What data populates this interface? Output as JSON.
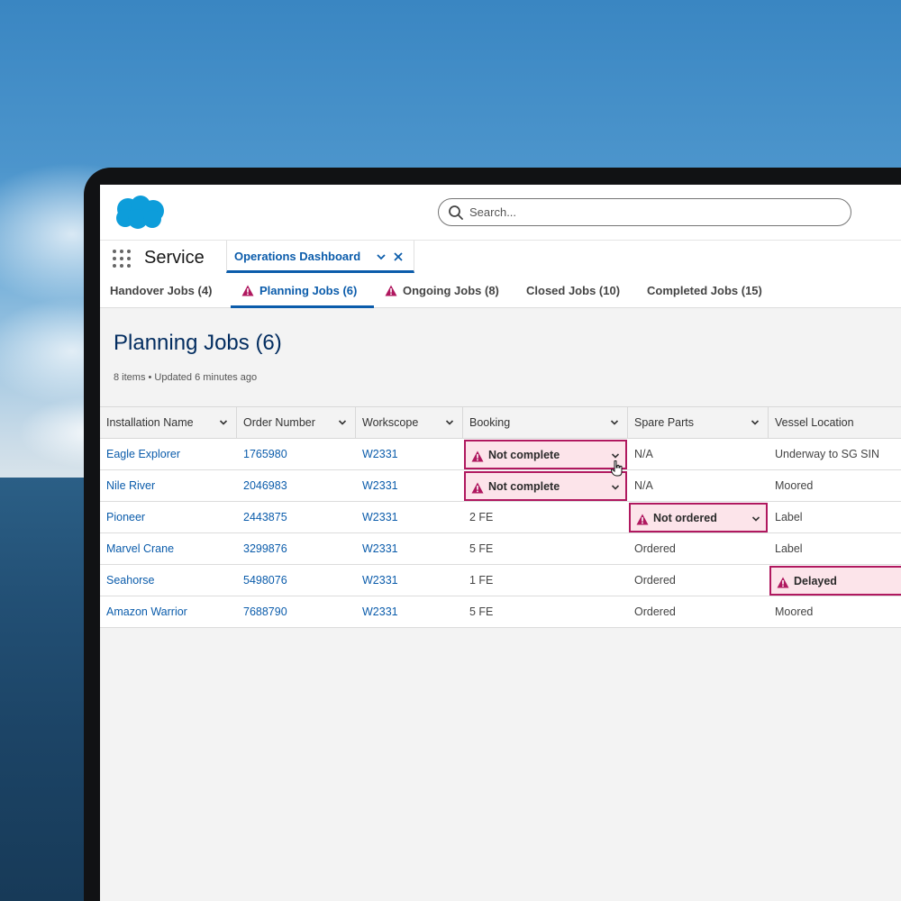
{
  "app": {
    "name": "Service"
  },
  "search": {
    "placeholder": "Search..."
  },
  "workspace_tab": {
    "label": "Operations Dashboard"
  },
  "subtabs": [
    {
      "label": "Handover Jobs (4)",
      "warning": false,
      "active": false
    },
    {
      "label": "Planning Jobs (6)",
      "warning": true,
      "active": true
    },
    {
      "label": "Ongoing Jobs (8)",
      "warning": true,
      "active": false
    },
    {
      "label": "Closed Jobs (10)",
      "warning": false,
      "active": false
    },
    {
      "label": "Completed Jobs (15)",
      "warning": false,
      "active": false
    }
  ],
  "page": {
    "title": "Planning Jobs (6)",
    "meta": "8 items • Updated 6 minutes ago"
  },
  "table": {
    "columns": [
      "Installation Name",
      "Order Number",
      "Workscope",
      "Booking",
      "Spare Parts",
      "Vessel Location"
    ],
    "rows": [
      {
        "installation": "Eagle Explorer",
        "order": "1765980",
        "workscope": "W2331",
        "booking": "Not complete",
        "booking_alert": true,
        "spare": "N/A",
        "spare_alert": false,
        "vessel": "Underway to SG SIN",
        "vessel_alert": false
      },
      {
        "installation": "Nile River",
        "order": "2046983",
        "workscope": "W2331",
        "booking": "Not complete",
        "booking_alert": true,
        "spare": "N/A",
        "spare_alert": false,
        "vessel": "Moored",
        "vessel_alert": false
      },
      {
        "installation": "Pioneer",
        "order": "2443875",
        "workscope": "W2331",
        "booking": "2 FE",
        "booking_alert": false,
        "spare": "Not ordered",
        "spare_alert": true,
        "vessel": "Label",
        "vessel_alert": false
      },
      {
        "installation": "Marvel Crane",
        "order": "3299876",
        "workscope": "W2331",
        "booking": "5 FE",
        "booking_alert": false,
        "spare": "Ordered",
        "spare_alert": false,
        "vessel": "Label",
        "vessel_alert": false
      },
      {
        "installation": "Seahorse",
        "order": "5498076",
        "workscope": "W2331",
        "booking": "1 FE",
        "booking_alert": false,
        "spare": "Ordered",
        "spare_alert": false,
        "vessel": "Delayed",
        "vessel_alert": true
      },
      {
        "installation": "Amazon Warrior",
        "order": "7688790",
        "workscope": "W2331",
        "booking": "5 FE",
        "booking_alert": false,
        "spare": "Ordered",
        "spare_alert": false,
        "vessel": "Moored",
        "vessel_alert": false
      }
    ]
  },
  "colors": {
    "brand_blue": "#0b5cab",
    "alert_border": "#b0185f",
    "alert_fill": "#fce4ea",
    "logo": "#0d9dda"
  },
  "icons": [
    "salesforce-cloud-logo",
    "search-icon",
    "app-launcher-icon",
    "chevron-down-icon",
    "close-icon",
    "warning-icon",
    "hand-cursor-icon"
  ]
}
